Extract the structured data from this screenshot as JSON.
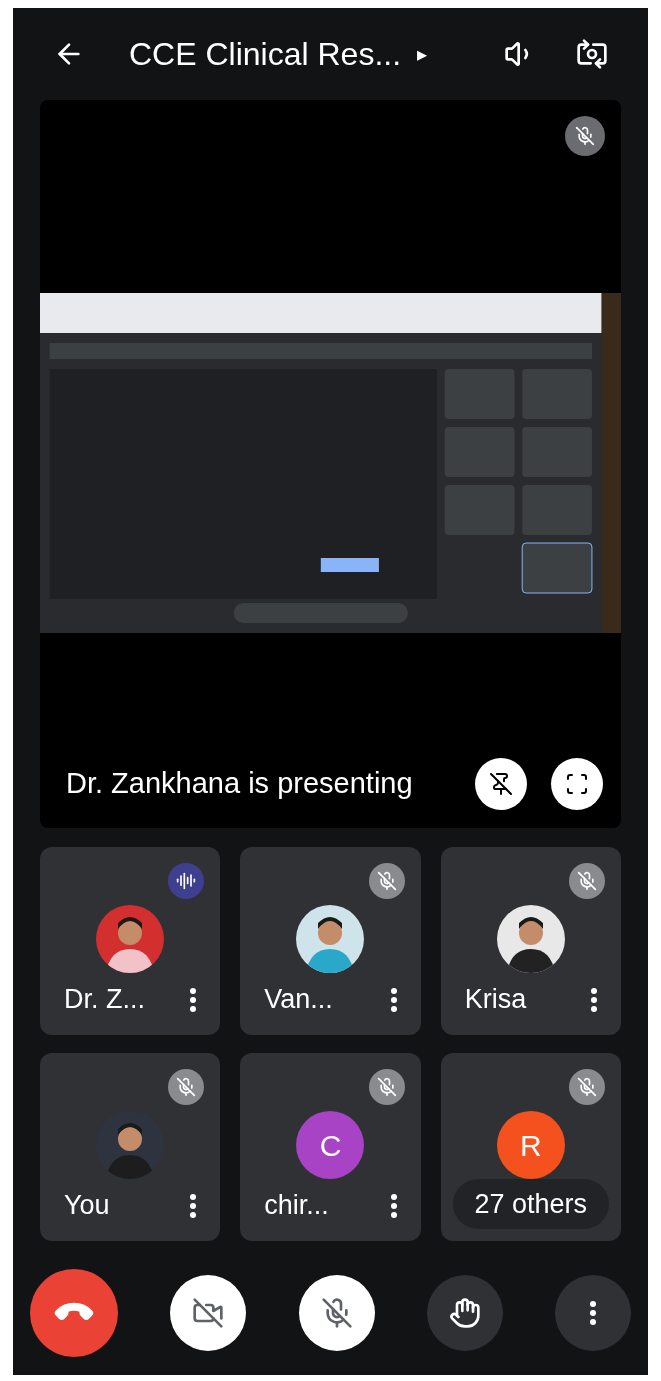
{
  "top_bar": {
    "title": "CCE Clinical Res...",
    "title_caret": "▸"
  },
  "presentation": {
    "kind": "picture",
    "presenter_muted": true,
    "caption": "Dr. Zankhana is presenting"
  },
  "participants": [
    {
      "name": "Dr. Z...",
      "muted": false
    },
    {
      "name": "Van...",
      "muted": true
    },
    {
      "name": "Krisa",
      "muted": true
    },
    {
      "name": "You",
      "muted": true
    },
    {
      "kind": "letter",
      "letter": "C",
      "color": "#a743c4",
      "name": "chir...",
      "muted": true
    },
    {
      "kind": "others",
      "letter": "R",
      "color": "#f4511e",
      "name": "27 others",
      "muted": true
    }
  ],
  "controls": [
    {
      "kind": "end_call"
    },
    {
      "kind": "camera",
      "on": false
    },
    {
      "kind": "mic",
      "on": false
    },
    {
      "kind": "raise_hand"
    },
    {
      "kind": "more"
    }
  ]
}
